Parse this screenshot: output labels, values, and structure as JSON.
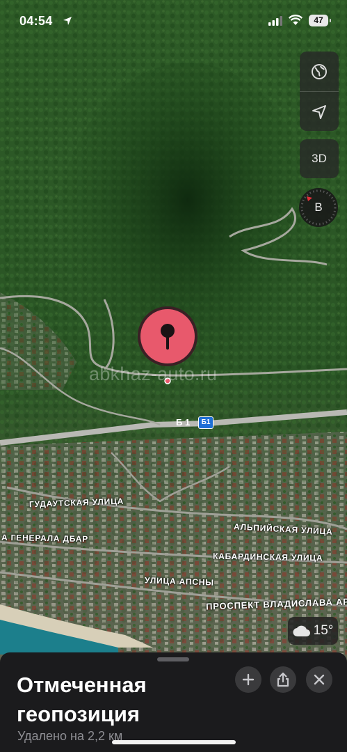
{
  "status_bar": {
    "time": "04:54",
    "battery": "47"
  },
  "map": {
    "watermark": "abkhaz-auto.ru",
    "road_number": "Б 1",
    "road_shield": "Б1",
    "streets": {
      "gudautskaya": "ГУДАУТСКАЯ УЛИЦА",
      "generala_dbar": "А ГЕНЕРАЛА ДБАР",
      "alpiyskaya": "АЛЬПИЙСКАЯ УЛИЦА",
      "kabardinskaya": "КАБАРДИНСКАЯ УЛИЦА",
      "apsny": "УЛИЦА АПСНЫ",
      "prospekt": "ПРОСПЕКТ ВЛАДИСЛАВА АР"
    }
  },
  "controls": {
    "globe_icon": "globe-icon",
    "location_icon": "location-arrow-icon",
    "view_3d": "3D",
    "compass_label": "В"
  },
  "weather": {
    "icon": "cloud-icon",
    "temperature": "15°"
  },
  "place_sheet": {
    "title": "Отмеченная геопозиция",
    "subtitle": "Удалено на 2,2 км",
    "actions": [
      "plus-icon",
      "share-icon",
      "close-icon"
    ]
  },
  "colors": {
    "pin": "#e8596c",
    "road_shield": "#1f6fd6",
    "compass_north": "#e0303a"
  }
}
